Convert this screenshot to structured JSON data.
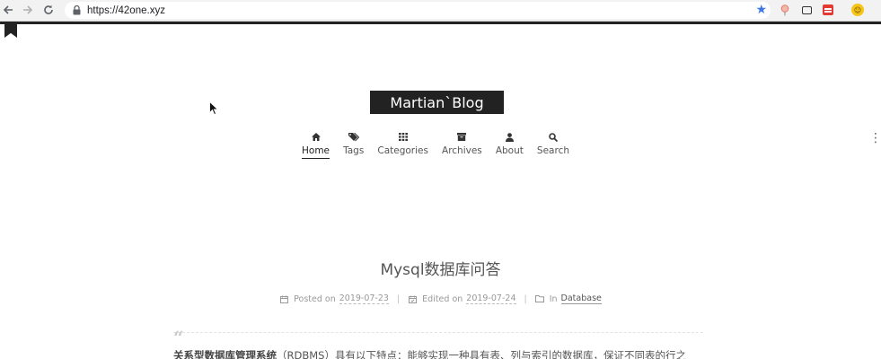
{
  "browser": {
    "url": "https://42one.xyz",
    "icons": {
      "back": "arrow-left",
      "forward": "arrow-right",
      "reload": "reload",
      "lock": "lock",
      "bookmark": "star",
      "extensions": [
        "pin",
        "window",
        "red-note",
        "profile"
      ],
      "menu": "vertical-dots"
    }
  },
  "site": {
    "brand": "Martian`Blog",
    "menu": [
      {
        "label": "Home",
        "icon": "home-icon",
        "active": true
      },
      {
        "label": "Tags",
        "icon": "tags-icon"
      },
      {
        "label": "Categories",
        "icon": "grid-icon"
      },
      {
        "label": "Archives",
        "icon": "archive-icon"
      },
      {
        "label": "About",
        "icon": "user-icon"
      },
      {
        "label": "Search",
        "icon": "search-icon"
      }
    ]
  },
  "post": {
    "title": "Mysql数据库问答",
    "meta": {
      "posted_label": "Posted on",
      "posted_date": "2019-07-23",
      "edited_label": "Edited on",
      "edited_date": "2019-07-24",
      "in_label": "In",
      "category": "Database",
      "separator": "|"
    },
    "quote_mark": "“",
    "excerpt_bold": "关系型数据库管理系统",
    "excerpt_rest": "（RDBMS）具有以下特点：能够实现一种具有表、列与索引的数据库，保证不同表的行之"
  },
  "colors": {
    "brand_bg": "#222222",
    "brand_text": "#ffffff",
    "star": "#3b78e7"
  }
}
